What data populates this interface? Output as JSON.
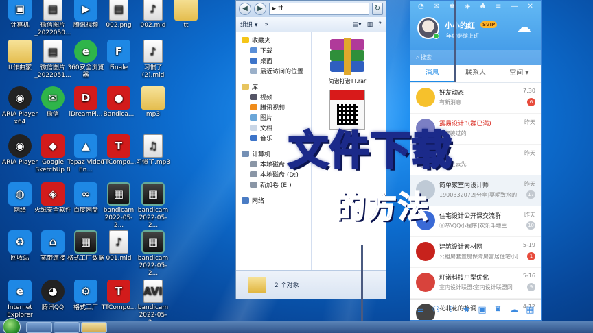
{
  "desktop": {
    "icons": [
      {
        "label": "计算机",
        "glyph": "▣"
      },
      {
        "label": "微信图片_2022050...",
        "glyph": "▤"
      },
      {
        "label": "腾讯视频",
        "glyph": "▶"
      },
      {
        "label": "002.png",
        "glyph": "▤"
      },
      {
        "label": "002.mid",
        "glyph": "♪"
      },
      {
        "label": "tt",
        "glyph": ""
      },
      {
        "label": "tt作曲家",
        "glyph": ""
      },
      {
        "label": "微信图片_2022051...",
        "glyph": "▤"
      },
      {
        "label": "360安全浏览器",
        "glyph": "e"
      },
      {
        "label": "Finale",
        "glyph": "F"
      },
      {
        "label": "习惯了(2).mid",
        "glyph": "♪"
      },
      {
        "label": "ARIA Player x64",
        "glyph": "◉"
      },
      {
        "label": "微信",
        "glyph": "✉"
      },
      {
        "label": "iDreamPi...",
        "glyph": "D"
      },
      {
        "label": "Bandica...",
        "glyph": "●"
      },
      {
        "label": "mp3",
        "glyph": ""
      },
      {
        "label": "ARIA Player",
        "glyph": "◉"
      },
      {
        "label": "Google SketchUp 8",
        "glyph": "◆"
      },
      {
        "label": "Topaz Video En...",
        "glyph": "▲"
      },
      {
        "label": "TTCompo...",
        "glyph": "T"
      },
      {
        "label": "习惯了.mp3",
        "glyph": "♫"
      },
      {
        "label": "网络",
        "glyph": "◍"
      },
      {
        "label": "火绒安全软件",
        "glyph": "◈"
      },
      {
        "label": "百度网盘",
        "glyph": "∞"
      },
      {
        "label": "bandicam 2022-05-2...",
        "glyph": "▦"
      },
      {
        "label": "bandicam 2022-05-2...",
        "glyph": "▦"
      },
      {
        "label": "回收站",
        "glyph": "♻"
      },
      {
        "label": "宽带连接",
        "glyph": "⌂"
      },
      {
        "label": "格式工厂数据",
        "glyph": "▦"
      },
      {
        "label": "001.mid",
        "glyph": "♪"
      },
      {
        "label": "bandicam 2022-05-2...",
        "glyph": "▦"
      },
      {
        "label": "Internet Explorer",
        "glyph": "e"
      },
      {
        "label": "腾讯QQ",
        "glyph": "◕"
      },
      {
        "label": "格式工厂",
        "glyph": "⚙"
      },
      {
        "label": "TTCompo...",
        "glyph": "T"
      },
      {
        "label": "bandicam 2022-05-2...",
        "glyph": "AVI"
      }
    ]
  },
  "explorer": {
    "path": "tt",
    "toolbar": {
      "organize": "组织 ▾",
      "more": "»"
    },
    "nav": {
      "favorites": "收藏夹",
      "downloads": "下载",
      "desktop": "桌面",
      "recent": "最近访问的位置",
      "library": "库",
      "video": "视频",
      "tencent_video": "腾讯视频",
      "pictures": "图片",
      "documents": "文档",
      "music": "音乐",
      "computer": "计算机",
      "disk_c": "本地磁盘 (C:)",
      "disk_d": "本地磁盘 (D:)",
      "disk_e": "新加卷 (E:)",
      "network": "网络"
    },
    "files": [
      {
        "name": "简谱打谱TT.rar"
      },
      {
        "name": "...动习..."
      }
    ],
    "status": "2 个对象"
  },
  "qq": {
    "name": "小小的红",
    "vip": "SVIP",
    "signature": "年后继续上班",
    "search_placeholder": "搜索",
    "tabs": [
      "消息",
      "联系人",
      "空间 ▾"
    ],
    "conversations": [
      {
        "name": "好友动态",
        "msg": "有新消息",
        "time": "7:30",
        "badge": "6",
        "color": "#f6c12c",
        "hot": false
      },
      {
        "name": "露易设计3(群已满)",
        "msg": "...安装过的",
        "time": "昨天",
        "badge": "",
        "color": "#7b7fc4",
        "hot": true
      },
      {
        "name": "...",
        "msg": "...：进去先",
        "time": "昨天",
        "badge": "",
        "color": "#aac",
        "hot": false
      },
      {
        "name": "简单家室内设计师",
        "msg": "1900332072[分享]莫呢致水的",
        "time": "昨天",
        "badge": "17",
        "color": "#bfcad6",
        "hot": false
      },
      {
        "name": "住宅设计公开课交流群",
        "msg": "ⓐ帝\\QQ小程序]欢乐斗地主",
        "time": "昨天",
        "badge": "10",
        "color": "#3a6ad6",
        "hot": false
      },
      {
        "name": "建筑设计素材网",
        "msg": "公租房套置房保障房富居住宅小区",
        "time": "5-19",
        "badge": "1",
        "color": "#c7221c",
        "hot": false
      },
      {
        "name": "籽诺科技户型优化",
        "msg": "室内设计联盟:室内设计联盟网",
        "time": "5-16",
        "badge": "9",
        "color": "#d8433c",
        "hot": false
      },
      {
        "name": "花非花的格调",
        "msg": "",
        "time": "4-12",
        "badge": "",
        "color": "#444",
        "hot": false
      }
    ]
  },
  "overlay": {
    "title": "文件下载",
    "subtitle": "的方法"
  }
}
